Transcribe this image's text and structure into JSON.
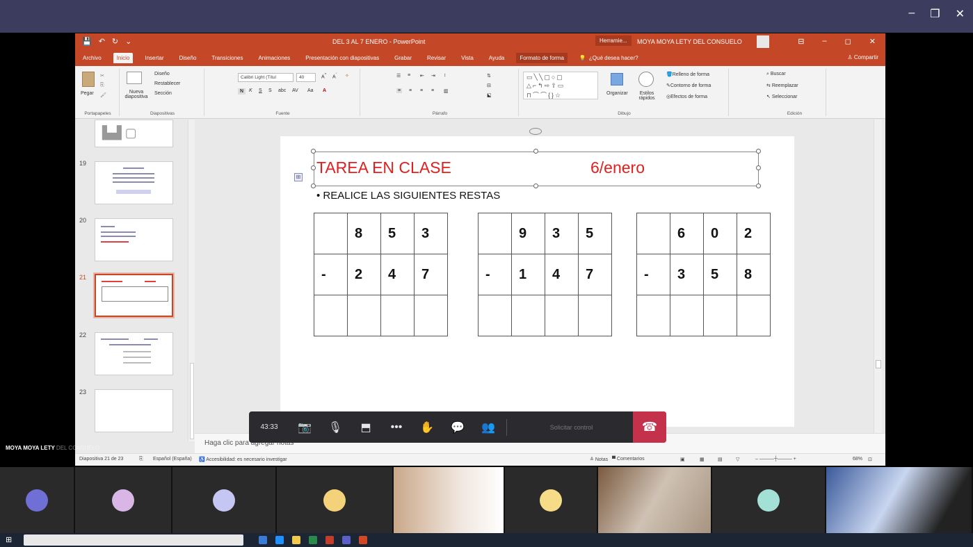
{
  "teams": {
    "window_controls": [
      "–",
      "❐",
      "✕"
    ]
  },
  "ppt": {
    "quick_access": [
      "💾",
      "↶",
      "↻",
      "⌄"
    ],
    "doc_title": "DEL 3 AL 7 ENERO - PowerPoint",
    "context_hint": "Herramie...",
    "user_name": "MOYA MOYA LETY DEL CONSUELO",
    "window_controls": [
      "⊟",
      "–",
      "◻",
      "✕"
    ],
    "tabs": [
      "Archivo",
      "Inicio",
      "Insertar",
      "Diseño",
      "Transiciones",
      "Animaciones",
      "Presentación con diapositivas",
      "Grabar",
      "Revisar",
      "Vista",
      "Ayuda",
      "Formato de forma"
    ],
    "search_label": "¿Qué desea hacer?",
    "share_label": "Compartir",
    "ribbon": {
      "paste": "Pegar",
      "clipboard": "Portapapeles",
      "new_slide": "Nueva diapositiva",
      "layout": "Diseño",
      "reset": "Restablecer",
      "section": "Sección",
      "slides": "Diapositivas",
      "font_name": "Calibri Light (Títul",
      "font_size": "40",
      "font": "Fuente",
      "paragraph": "Párrafo",
      "arrange": "Organizar",
      "quick_styles": "Estilos rápidos",
      "shape_fill": "Relleno de forma",
      "shape_outline": "Contorno de forma",
      "shape_effects": "Efectos de forma",
      "drawing": "Dibujo",
      "find": "Buscar",
      "replace": "Reemplazar",
      "select": "Seleccionar",
      "editing": "Edición"
    },
    "thumbnails": [
      "19",
      "20",
      "21",
      "22",
      "23"
    ],
    "notes_placeholder": "Haga clic para agregar notas",
    "status": {
      "slide_of": "Diapositiva 21 de 23",
      "language": "Español (España)",
      "accessibility": "Accesibilidad: es necesario investigar",
      "notes": "Notas",
      "comments": "Comentarios",
      "zoom": "68%"
    }
  },
  "slide": {
    "title": "TAREA EN CLASE",
    "date": "6/enero",
    "instruction": "REALICE LAS SIGUIENTES RESTAS",
    "problems": [
      {
        "top": [
          "",
          "8",
          "5",
          "3"
        ],
        "bottom": [
          "-",
          "2",
          "4",
          "7"
        ]
      },
      {
        "top": [
          "",
          "9",
          "3",
          "5"
        ],
        "bottom": [
          "-",
          "1",
          "4",
          "7"
        ]
      },
      {
        "top": [
          "",
          "6",
          "0",
          "2"
        ],
        "bottom": [
          "-",
          "3",
          "5",
          "8"
        ]
      }
    ]
  },
  "meeting": {
    "timer": "43:33",
    "request_control": "Solicitar control",
    "icons": [
      "camera-off-icon",
      "mic-off-icon",
      "share-tray-icon",
      "more-icon",
      "raise-hand-icon",
      "chat-icon",
      "participants-icon",
      "hangup-icon"
    ]
  },
  "presenter": {
    "name_visible": "MOYA MOYA LETY",
    "name_faded": "DEL CONSUELO"
  },
  "participants": [
    {
      "initials": "",
      "color": "#6f6fd6"
    },
    {
      "initials": "",
      "color": "#d9b6e6"
    },
    {
      "initials": "",
      "color": "#c5c7f2"
    },
    {
      "initials": "",
      "color": "#f3d27a"
    },
    {
      "initials": "",
      "color": "#c9b8a8"
    },
    {
      "initials": "",
      "color": "#f6dc86"
    },
    {
      "initials": "",
      "color": "#9a8a7a"
    },
    {
      "initials": "",
      "color": "#a3e0d6"
    },
    {
      "initials": "",
      "color": "#5d6d90"
    }
  ]
}
